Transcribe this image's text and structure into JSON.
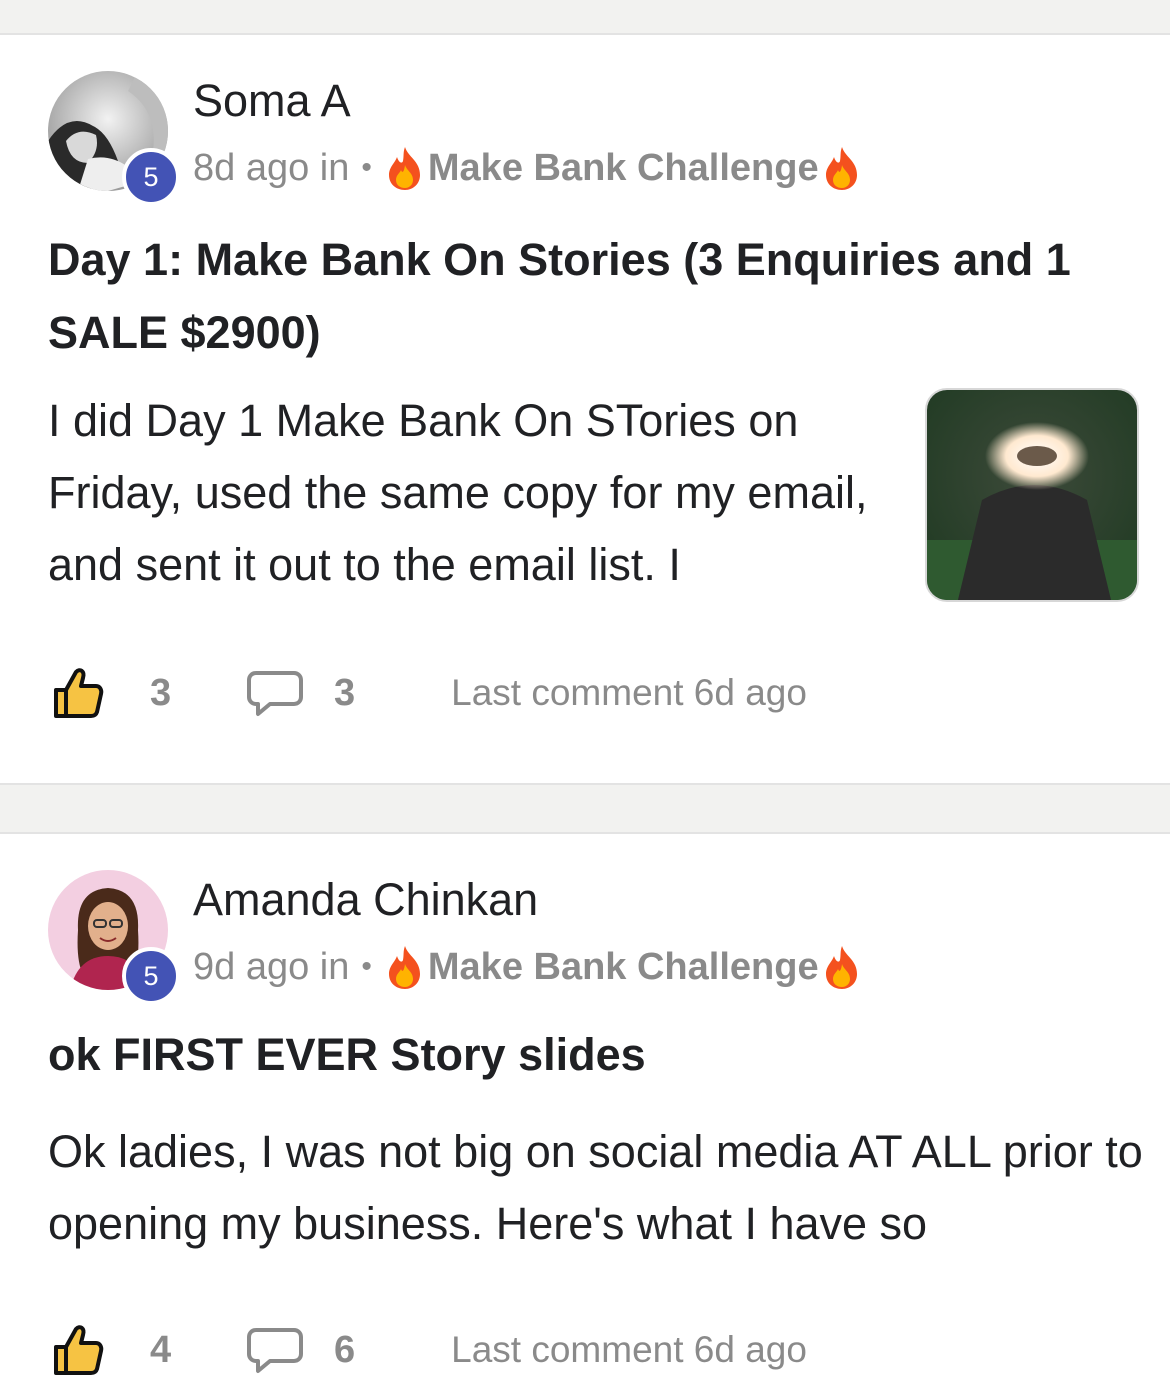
{
  "posts": [
    {
      "author": "Soma A",
      "level": "5",
      "time": "8d ago in",
      "separator": "•",
      "category": "Make Bank Challenge",
      "title": "Day 1: Make Bank On Stories (3 Enquiries and 1 SALE $2900)",
      "body": "I did Day 1 Make Bank On STories on Friday, used the same copy for my email, and sent it out to the email list. I",
      "likes": "3",
      "comments": "3",
      "last_comment": "Last comment 6d ago",
      "has_thumbnail": true
    },
    {
      "author": "Amanda Chinkan",
      "level": "5",
      "time": "9d ago in",
      "separator": "•",
      "category": "Make Bank Challenge",
      "title": "ok FIRST EVER Story slides",
      "body": "Ok ladies, I was not big on social media AT ALL prior to opening my business. Here's what I have so",
      "likes": "4",
      "comments": "6",
      "last_comment": "Last comment 6d ago",
      "has_thumbnail": false
    }
  ],
  "icons": {
    "like": "thumbs-up-icon",
    "comment": "comment-bubble-icon",
    "category": "fire-emoji-icon"
  },
  "colors": {
    "level_badge": "#4353b5",
    "muted_text": "#8a8a8a",
    "primary_text": "#202124"
  }
}
